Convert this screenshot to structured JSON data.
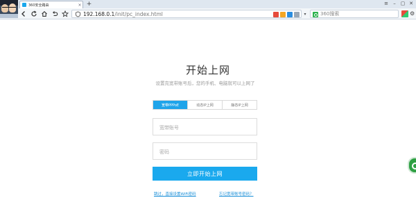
{
  "browser": {
    "tab": {
      "title": "360安全路由",
      "close": "×"
    },
    "new_tab": "+",
    "window_controls": [
      "≡",
      "–",
      "▢",
      "✕"
    ],
    "address": {
      "host": "192.168.0.1",
      "path": "/init/pc_index.html"
    },
    "search": {
      "placeholder": "360搜索"
    },
    "icons": [
      "back-icon",
      "refresh-icon",
      "home-icon",
      "undo-icon",
      "star-icon",
      "shield-icon",
      "extensions-icon",
      "settings-icon"
    ]
  },
  "page": {
    "title": "开始上网",
    "subtitle": "设置完宽带账号后，您的手机、电脑就可以上网了",
    "modes": [
      {
        "label": "宽带PPPoE",
        "active": true
      },
      {
        "label": "动态IP上网",
        "active": false
      },
      {
        "label": "静态IP上网",
        "active": false
      }
    ],
    "account_placeholder": "宽带账号",
    "password_placeholder": "密码",
    "submit_label": "立即开始上网",
    "skip_link": "跳过，直接设置WiFi密码",
    "forgot_link": "忘记宽带账号密码？"
  },
  "colors": {
    "accent": "#1aa9ee",
    "tab_active": "#1fa4ea",
    "link": "#1a8fd8"
  }
}
